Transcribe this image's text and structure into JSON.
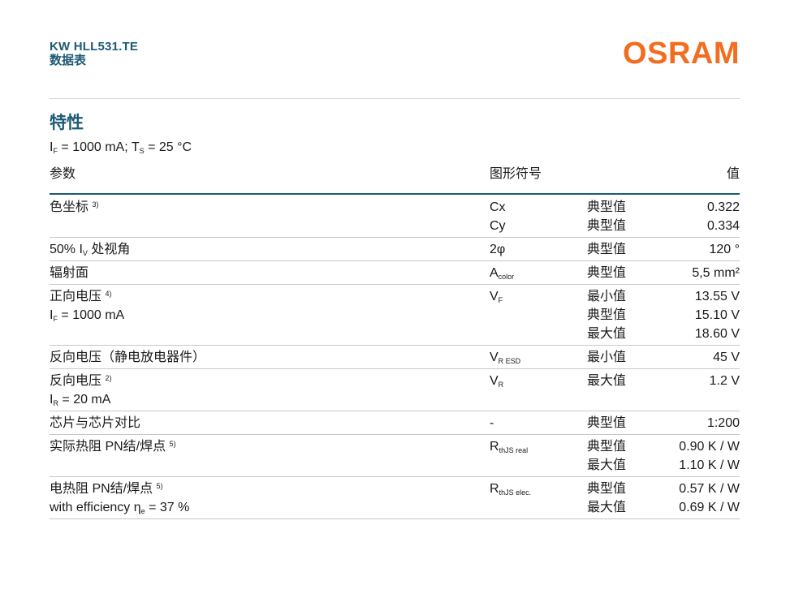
{
  "header": {
    "product": "KW HLL531.TE",
    "doc_type": "数据表",
    "logo_text": "OSRAM"
  },
  "section": {
    "title": "特性",
    "conditions": {
      "if_symbol": "I",
      "if_sub": "F",
      "if_value": " = 1000 mA; T",
      "ts_sub": "S",
      "ts_value": " = 25 °C"
    }
  },
  "table": {
    "columns": [
      "参数",
      "图形符号",
      "值"
    ],
    "rows": [
      {
        "param": "色坐标",
        "param_note": "3)",
        "symbols": [
          "Cx",
          "Cy"
        ],
        "kinds": [
          "典型值",
          "典型值"
        ],
        "values": [
          "0.322",
          "0.334"
        ]
      },
      {
        "param_pre": "50% I",
        "param_sub": "V",
        "param_post": " 处视角",
        "symbol": "2φ",
        "kinds": [
          "典型值"
        ],
        "values": [
          "120 °"
        ]
      },
      {
        "param": "辐射面",
        "symbol": "A",
        "symbol_sub": "color",
        "kinds": [
          "典型值"
        ],
        "values": [
          "5,5 mm²"
        ]
      },
      {
        "param": "正向电压",
        "param_note": "4)",
        "cond_pre": "I",
        "cond_sub": "F",
        "cond_post": " = 1000 mA",
        "symbol": "V",
        "symbol_sub": "F",
        "kinds": [
          "最小值",
          "典型值",
          "最大值"
        ],
        "values": [
          "13.55 V",
          "15.10 V",
          "18.60 V"
        ]
      },
      {
        "param": "反向电压（静电放电器件）",
        "symbol": "V",
        "symbol_sub": "R ESD",
        "kinds": [
          "最小值"
        ],
        "values": [
          "45 V"
        ]
      },
      {
        "param": "反向电压",
        "param_note": "2)",
        "cond_pre": "I",
        "cond_sub": "R",
        "cond_post": " = 20 mA",
        "symbol": "V",
        "symbol_sub": "R",
        "kinds": [
          "最大值"
        ],
        "values": [
          "1.2 V"
        ]
      },
      {
        "param": "芯片与芯片对比",
        "symbol": "-",
        "kinds": [
          "典型值"
        ],
        "values": [
          "1:200"
        ]
      },
      {
        "param": "实际热阻 PN结/焊点",
        "param_note": "5)",
        "symbol": "R",
        "symbol_sub": "thJS real",
        "kinds": [
          "典型值",
          "最大值"
        ],
        "values": [
          "0.90 K / W",
          "1.10 K / W"
        ]
      },
      {
        "param": "电热阻 PN结/焊点",
        "param_note": "5)",
        "cond_pre": "with efficiency η",
        "cond_sub": "e",
        "cond_post": " = 37 %",
        "symbol": "R",
        "symbol_sub": "thJS elec.",
        "kinds": [
          "典型值",
          "最大值"
        ],
        "values": [
          "0.57 K / W",
          "0.69 K / W"
        ]
      }
    ]
  },
  "colors": {
    "heading": "#1d5a74",
    "logo": "#f36d21",
    "rule": "#c8c8c8"
  }
}
